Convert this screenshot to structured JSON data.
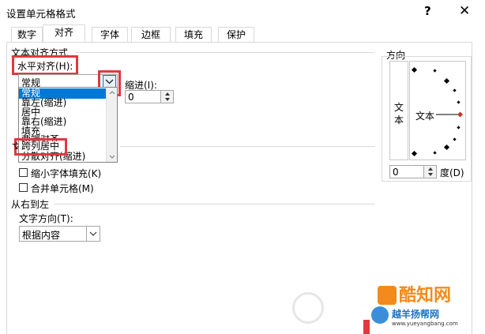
{
  "window": {
    "title": "设置单元格格式",
    "help_glyph": "?",
    "close_glyph": "✕"
  },
  "tabs": [
    {
      "label": "数字",
      "active": false
    },
    {
      "label": "对齐",
      "active": true
    },
    {
      "label": "字体",
      "active": false
    },
    {
      "label": "边框",
      "active": false
    },
    {
      "label": "填充",
      "active": false
    },
    {
      "label": "保护",
      "active": false
    }
  ],
  "text_alignment": {
    "group_label": "文本对齐方式",
    "horizontal_label": "水平对齐(H):",
    "horizontal_value": "常规",
    "indent_label": "缩进(I):",
    "indent_value": "0",
    "dropdown_options": [
      "常规",
      "靠左(缩进)",
      "居中",
      "靠右(缩进)",
      "填充",
      "两端对齐",
      "跨列居中",
      "分散对齐(缩进)"
    ],
    "selected_option": "常规",
    "highlighted_option": "跨列居中"
  },
  "text_control": {
    "shrink_label": "缩小字体填充(K)",
    "merge_label": "合并单元格(M)",
    "shrink_checked": false,
    "merge_checked": false
  },
  "rtl": {
    "group_label": "从右到左",
    "direction_label": "文字方向(T):",
    "direction_value": "根据内容"
  },
  "orientation": {
    "group_label": "方向",
    "vertical_text": "文本",
    "horizontal_text": "文本",
    "degree_value": "0",
    "degree_label": "度(D)"
  },
  "watermark": {
    "brand_text": "酷知网",
    "site_name": "越羊扬帮网",
    "site_url": "www.yueyangbang.com"
  },
  "colors": {
    "highlight_red": "#e0393e",
    "selection_blue": "#0078d7",
    "marker_red": "#c0392b"
  }
}
